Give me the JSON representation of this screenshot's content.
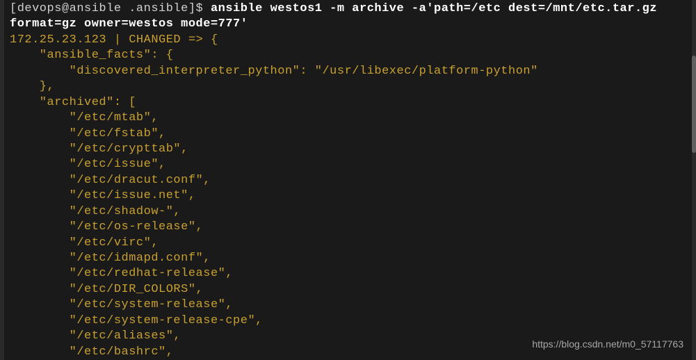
{
  "prompt": {
    "user_host": "[devops@ansible .ansible]$ ",
    "command_line1": "ansible westos1 -m archive -a'path=/etc dest=/mnt/etc.tar.gz",
    "command_line2": "format=gz owner=westos mode=777'"
  },
  "output": {
    "host_status": "172.25.23.123 | CHANGED => {",
    "facts_key": "    \"ansible_facts\": {",
    "interpreter_line": "        \"discovered_interpreter_python\": \"/usr/libexec/platform-python\"",
    "facts_close": "    },",
    "archived_key": "    \"archived\": [",
    "files": [
      "        \"/etc/mtab\",",
      "        \"/etc/fstab\",",
      "        \"/etc/crypttab\",",
      "        \"/etc/issue\",",
      "        \"/etc/dracut.conf\",",
      "        \"/etc/issue.net\",",
      "        \"/etc/shadow-\",",
      "        \"/etc/os-release\",",
      "        \"/etc/virc\",",
      "        \"/etc/idmapd.conf\",",
      "        \"/etc/redhat-release\",",
      "        \"/etc/DIR_COLORS\",",
      "        \"/etc/system-release\",",
      "        \"/etc/system-release-cpe\",",
      "        \"/etc/aliases\",",
      "        \"/etc/bashrc\","
    ]
  },
  "watermark": "https://blog.csdn.net/m0_57117763"
}
